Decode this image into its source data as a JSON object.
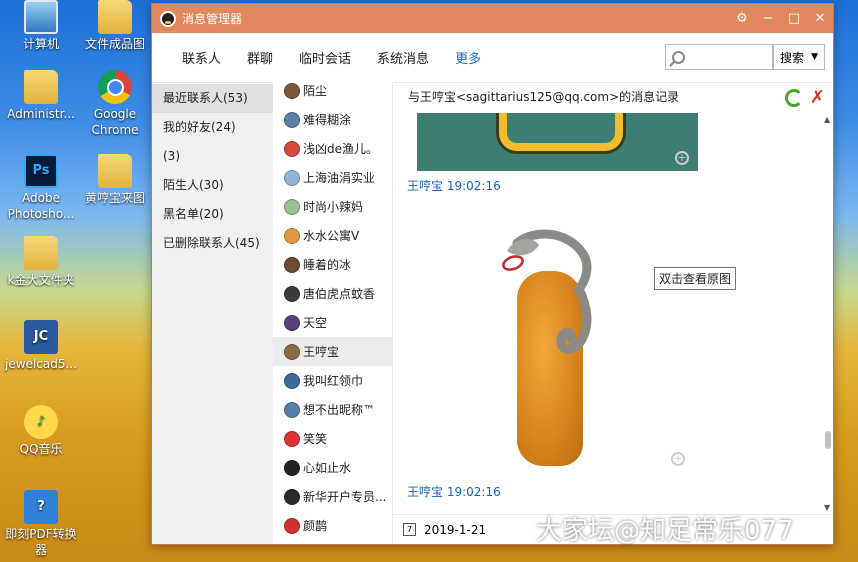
{
  "desktop": {
    "icons": [
      {
        "label": "计算机",
        "glyph": ""
      },
      {
        "label": "文件成品图",
        "glyph": ""
      },
      {
        "label": "Administr...",
        "glyph": ""
      },
      {
        "label": "Google Chrome",
        "glyph": ""
      },
      {
        "label": "Adobe Photosho...",
        "glyph": "Ps"
      },
      {
        "label": "黄哼宝来图",
        "glyph": ""
      },
      {
        "label": "k金大文件夹",
        "glyph": ""
      },
      {
        "label": "jewelcad5...",
        "glyph": "JC"
      },
      {
        "label": "QQ音乐",
        "glyph": "♪"
      },
      {
        "label": "即刻PDF转换器",
        "glyph": "?"
      }
    ]
  },
  "window": {
    "title": "消息管理器",
    "controls": {
      "skin": "⚙",
      "minimize": "−",
      "maximize": "□",
      "close": "✕"
    }
  },
  "toolbar": {
    "tabs": [
      "联系人",
      "群聊",
      "临时会话",
      "系统消息",
      "更多"
    ],
    "active_tab": "更多",
    "search_placeholder": "",
    "search_button": "搜索",
    "search_arrow": "▼"
  },
  "sidebar": {
    "groups": [
      "最近联系人(53)",
      "我的好友(24)",
      "(3)",
      "陌生人(30)",
      "黑名单(20)",
      "已删除联系人(45)"
    ],
    "selected_index": 0
  },
  "contacts": {
    "items": [
      {
        "name": "陌尘",
        "color": "#7a5a3c"
      },
      {
        "name": "难得糊涂",
        "color": "#5d7fa8"
      },
      {
        "name": "浅凶de渔儿。",
        "color": "#d84a3a"
      },
      {
        "name": "上海油涓实业",
        "color": "#8fb6d8"
      },
      {
        "name": "时尚小辣妈",
        "color": "#9bbf93"
      },
      {
        "name": "水水公寓V",
        "color": "#e09844"
      },
      {
        "name": "睡着的冰",
        "color": "#6c4a35"
      },
      {
        "name": "唐伯虎点蚊香",
        "color": "#3b3b3b"
      },
      {
        "name": "天空",
        "color": "#5b3e7c"
      },
      {
        "name": "王哼宝",
        "color": "#8a6a42"
      },
      {
        "name": "我叫红领巾",
        "color": "#3d6c98"
      },
      {
        "name": "想不出昵称™",
        "color": "#567fa7"
      },
      {
        "name": "笑笑",
        "color": "#222222"
      },
      {
        "name": "心如止水",
        "color": "#222222"
      },
      {
        "name": "新华开户专员...",
        "color": "#2a2a2a"
      },
      {
        "name": "颜鹊",
        "color": "#222222"
      }
    ],
    "selected_index": 9
  },
  "content": {
    "header": "与王哼宝<sagittarius125@qq.com>的消息记录",
    "messages": [
      {
        "sender": "王哼宝",
        "time": "19:02:16"
      },
      {
        "sender": "王哼宝",
        "time": "19:02:16"
      }
    ],
    "tooltip": "双击查看原图",
    "date": "2019-1-21",
    "calendar_glyph": "7"
  },
  "watermark": "大家坛@知足常乐077",
  "colors": {
    "titlebar": "#e0875c",
    "accent": "#1a68c8"
  }
}
